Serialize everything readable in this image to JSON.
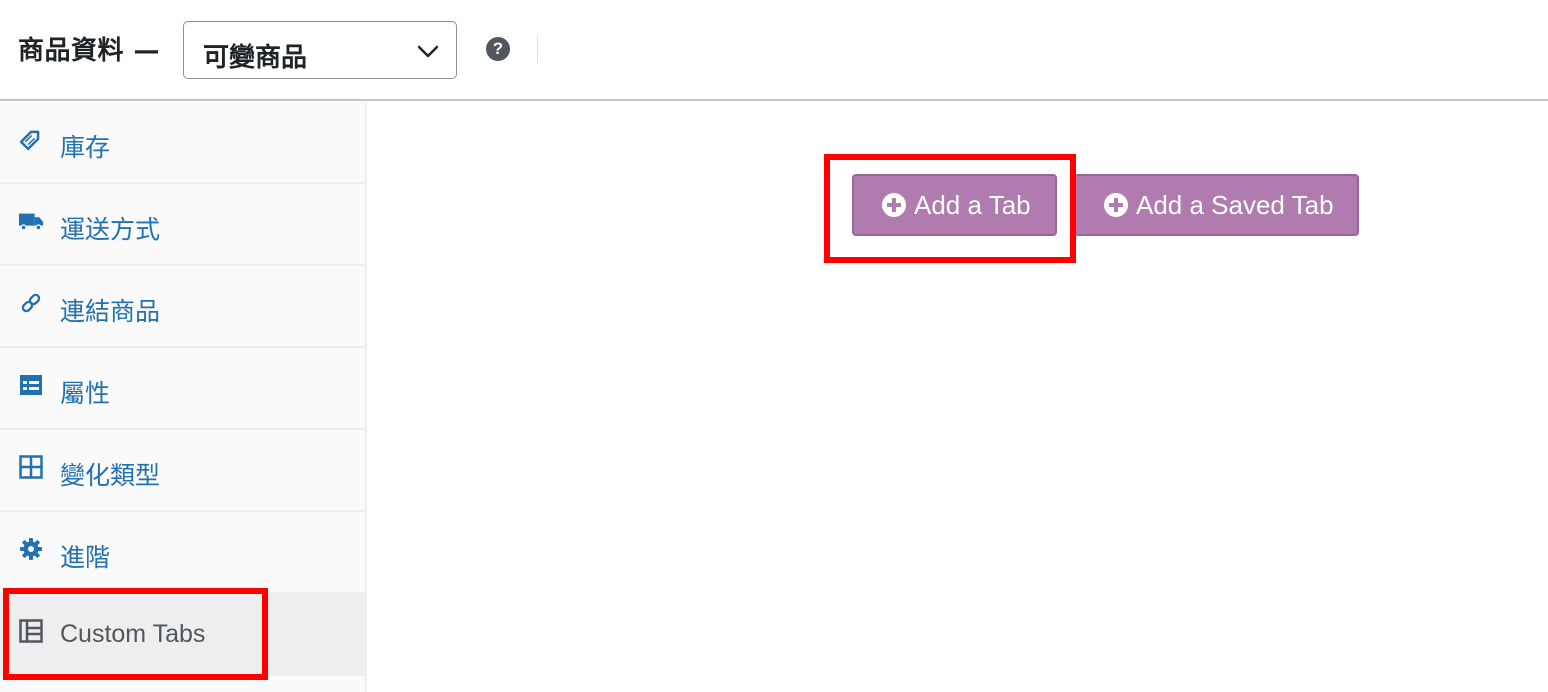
{
  "header": {
    "title": "商品資料 —",
    "product_type_select": {
      "value": "可變商品"
    },
    "help_icon": "?"
  },
  "sidebar": {
    "items": [
      {
        "label": "庫存",
        "icon": "tag-icon"
      },
      {
        "label": "運送方式",
        "icon": "truck-icon"
      },
      {
        "label": "連結商品",
        "icon": "link-icon"
      },
      {
        "label": "屬性",
        "icon": "list-table-icon"
      },
      {
        "label": "變化類型",
        "icon": "grid-icon"
      },
      {
        "label": "進階",
        "icon": "gear-icon"
      },
      {
        "label": "Custom Tabs",
        "icon": "tabs-layout-icon",
        "active": true
      }
    ]
  },
  "main": {
    "add_tab_label": "Add a Tab",
    "add_saved_tab_label": "Add a Saved Tab"
  },
  "colors": {
    "accent_purple": "#b07bae",
    "link_blue": "#2271b1",
    "highlight_red": "#ff0000"
  }
}
